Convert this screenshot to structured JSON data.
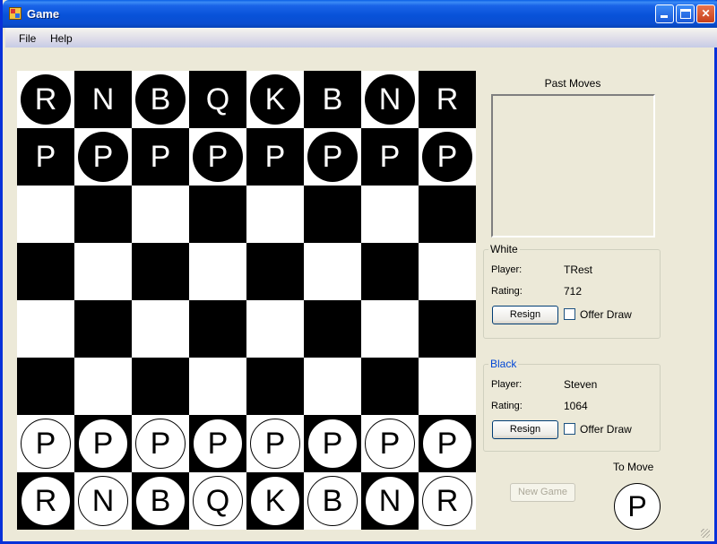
{
  "window": {
    "title": "Game"
  },
  "menu": {
    "file": "File",
    "help": "Help"
  },
  "board": {
    "rows": [
      [
        {
          "p": "R",
          "c": "b"
        },
        {
          "p": "N",
          "c": "b"
        },
        {
          "p": "B",
          "c": "b"
        },
        {
          "p": "Q",
          "c": "b"
        },
        {
          "p": "K",
          "c": "b"
        },
        {
          "p": "B",
          "c": "b"
        },
        {
          "p": "N",
          "c": "b"
        },
        {
          "p": "R",
          "c": "b"
        }
      ],
      [
        {
          "p": "P",
          "c": "b"
        },
        {
          "p": "P",
          "c": "b"
        },
        {
          "p": "P",
          "c": "b"
        },
        {
          "p": "P",
          "c": "b"
        },
        {
          "p": "P",
          "c": "b"
        },
        {
          "p": "P",
          "c": "b"
        },
        {
          "p": "P",
          "c": "b"
        },
        {
          "p": "P",
          "c": "b"
        }
      ],
      [
        null,
        null,
        null,
        null,
        null,
        null,
        null,
        null
      ],
      [
        null,
        null,
        null,
        null,
        null,
        null,
        null,
        null
      ],
      [
        null,
        null,
        null,
        null,
        null,
        null,
        null,
        null
      ],
      [
        null,
        null,
        null,
        null,
        null,
        null,
        null,
        null
      ],
      [
        {
          "p": "P",
          "c": "w"
        },
        {
          "p": "P",
          "c": "w"
        },
        {
          "p": "P",
          "c": "w"
        },
        {
          "p": "P",
          "c": "w"
        },
        {
          "p": "P",
          "c": "w"
        },
        {
          "p": "P",
          "c": "w"
        },
        {
          "p": "P",
          "c": "w"
        },
        {
          "p": "P",
          "c": "w"
        }
      ],
      [
        {
          "p": "R",
          "c": "w"
        },
        {
          "p": "N",
          "c": "w"
        },
        {
          "p": "B",
          "c": "w"
        },
        {
          "p": "Q",
          "c": "w"
        },
        {
          "p": "K",
          "c": "w"
        },
        {
          "p": "B",
          "c": "w"
        },
        {
          "p": "N",
          "c": "w"
        },
        {
          "p": "R",
          "c": "w"
        }
      ]
    ]
  },
  "past_moves": {
    "label": "Past Moves"
  },
  "white": {
    "title": "White",
    "player_label": "Player:",
    "player": "TRest",
    "rating_label": "Rating:",
    "rating": "712",
    "resign": "Resign",
    "offer_draw": "Offer Draw"
  },
  "black": {
    "title": "Black",
    "player_label": "Player:",
    "player": "Steven",
    "rating_label": "Rating:",
    "rating": "1064",
    "resign": "Resign",
    "offer_draw": "Offer Draw"
  },
  "new_game": "New Game",
  "to_move": {
    "label": "To Move",
    "piece": "P"
  },
  "colors": {
    "titlebar": "#0852d9",
    "board_dark": "#000000",
    "board_light": "#ffffff",
    "black_title": "#0046d5"
  }
}
